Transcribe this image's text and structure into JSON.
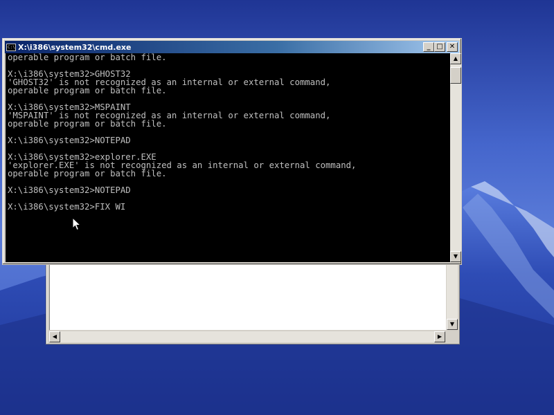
{
  "window": {
    "title": "X:\\i386\\system32\\cmd.exe",
    "icon_text": "C:\\",
    "minimize_glyph": "_",
    "maximize_glyph": "□",
    "close_glyph": "✕"
  },
  "console": {
    "lines": [
      "operable program or batch file.",
      "",
      "X:\\i386\\system32>GHOST32",
      "'GHOST32' is not recognized as an internal or external command,",
      "operable program or batch file.",
      "",
      "X:\\i386\\system32>MSPAINT",
      "'MSPAINT' is not recognized as an internal or external command,",
      "operable program or batch file.",
      "",
      "X:\\i386\\system32>NOTEPAD",
      "",
      "X:\\i386\\system32>explorer.EXE",
      "'explorer.EXE' is not recognized as an internal or external command,",
      "operable program or batch file.",
      "",
      "X:\\i386\\system32>NOTEPAD",
      "",
      "X:\\i386\\system32>FIX WI"
    ]
  },
  "scrollbar": {
    "up_glyph": "▲",
    "down_glyph": "▼",
    "left_glyph": "◀",
    "right_glyph": "▶"
  },
  "icons": {
    "cursor": "arrow-cursor-icon",
    "window_icon": "console-icon"
  },
  "colors": {
    "title_active": "#0a246a",
    "console_bg": "#000000",
    "console_text": "#c0c0c0",
    "chrome": "#d4d0c8"
  }
}
